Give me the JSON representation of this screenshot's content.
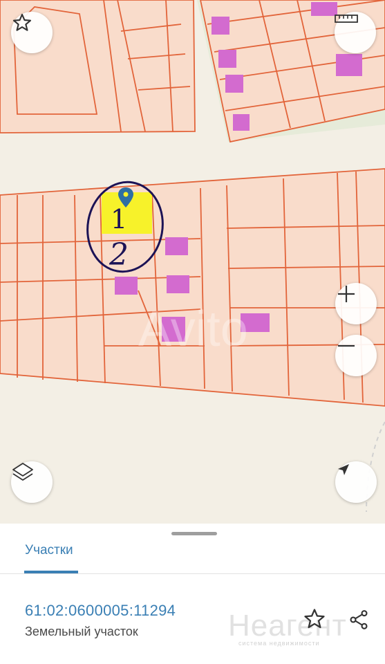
{
  "map": {
    "annotation": {
      "text_1": "1",
      "text_2": "2"
    },
    "watermark": "Avito",
    "controls": {
      "favorite_icon": "star-outline-icon",
      "ruler_icon": "ruler-icon",
      "zoom_in_icon": "plus-icon",
      "zoom_out_icon": "minus-icon",
      "layers_icon": "layers-icon",
      "location_icon": "navigation-arrow-icon"
    },
    "colors": {
      "background": "#f3efe5",
      "parcel_fill": "#f9dccb",
      "parcel_border": "#e2643a",
      "building": "#d36bcf",
      "selected_parcel": "#f7f22a",
      "marker": "#2e6fa3",
      "annotation_ink": "#1c1356"
    }
  },
  "sheet": {
    "tab_label": "Участки",
    "cadastral_number": "61:02:0600005:11294",
    "parcel_type": "Земельный участок",
    "watermark_big": "Неагент",
    "watermark_small": "система недвижимости",
    "accent": "#3a7fb4"
  }
}
